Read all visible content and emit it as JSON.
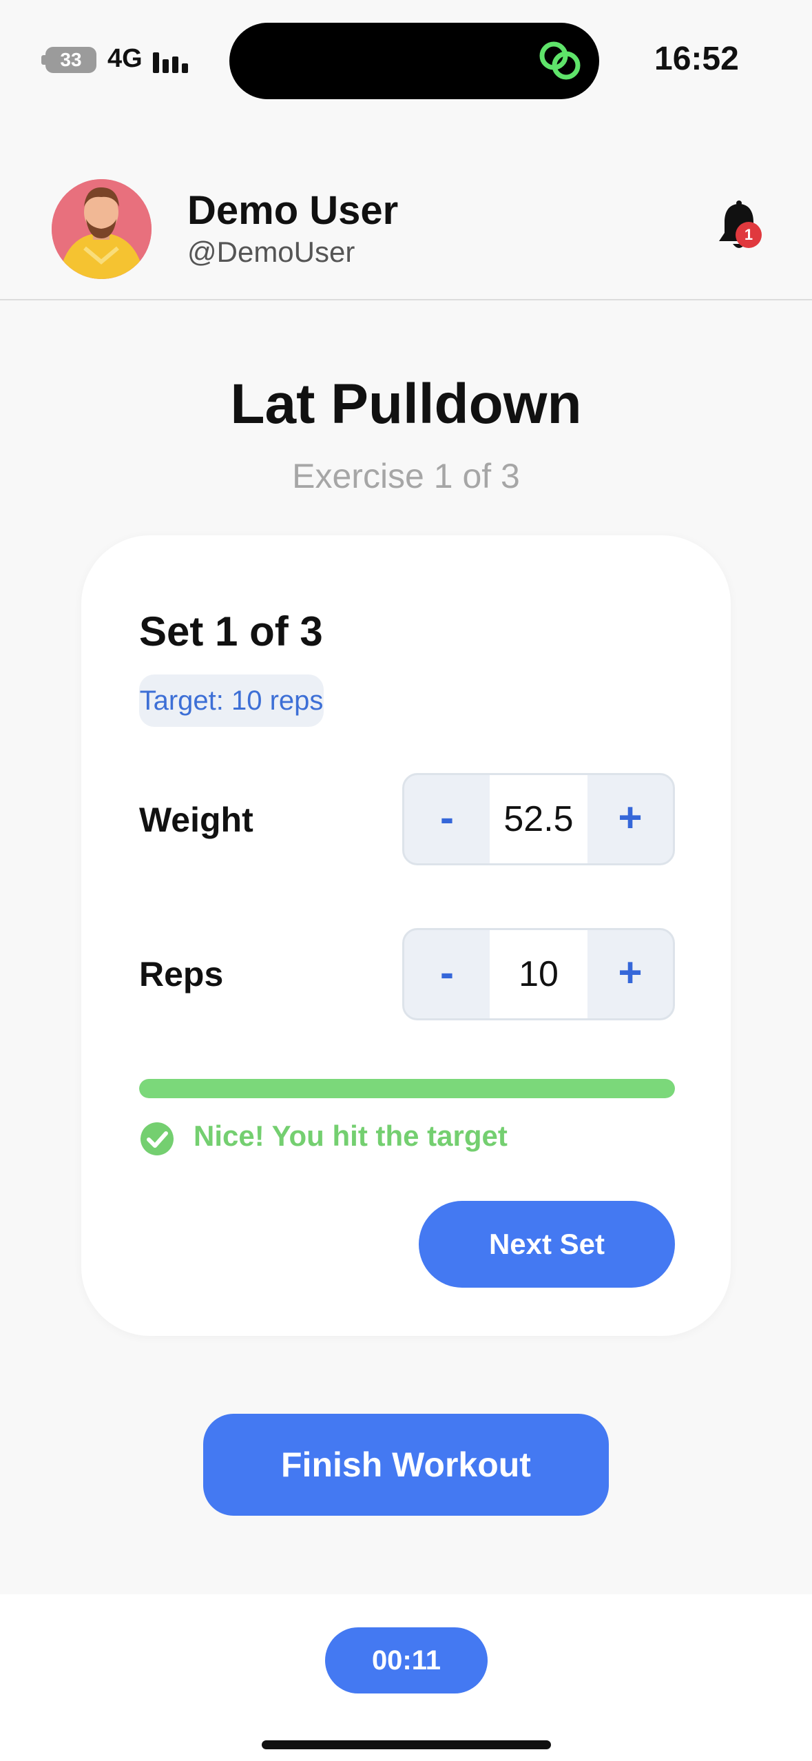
{
  "status_bar": {
    "battery": "33",
    "network": "4G",
    "time": "16:52"
  },
  "header": {
    "user_name": "Demo User",
    "user_handle": "@DemoUser",
    "notification_count": "1"
  },
  "exercise": {
    "title": "Lat Pulldown",
    "subtitle": "Exercise 1 of 3"
  },
  "set_card": {
    "set_title": "Set 1 of 3",
    "target": "Target: 10 reps",
    "weight": {
      "label": "Weight",
      "minus": "-",
      "value": "52.5",
      "plus": "+"
    },
    "reps": {
      "label": "Reps",
      "minus": "-",
      "value": "10",
      "plus": "+"
    },
    "progress_fraction": 1.0,
    "success_message": "Nice! You hit the target",
    "next_button": "Next Set"
  },
  "finish_button": "Finish Workout",
  "timer": "00:11",
  "colors": {
    "accent": "#4479f2",
    "success": "#74cf70",
    "badge": "#e0393e"
  }
}
